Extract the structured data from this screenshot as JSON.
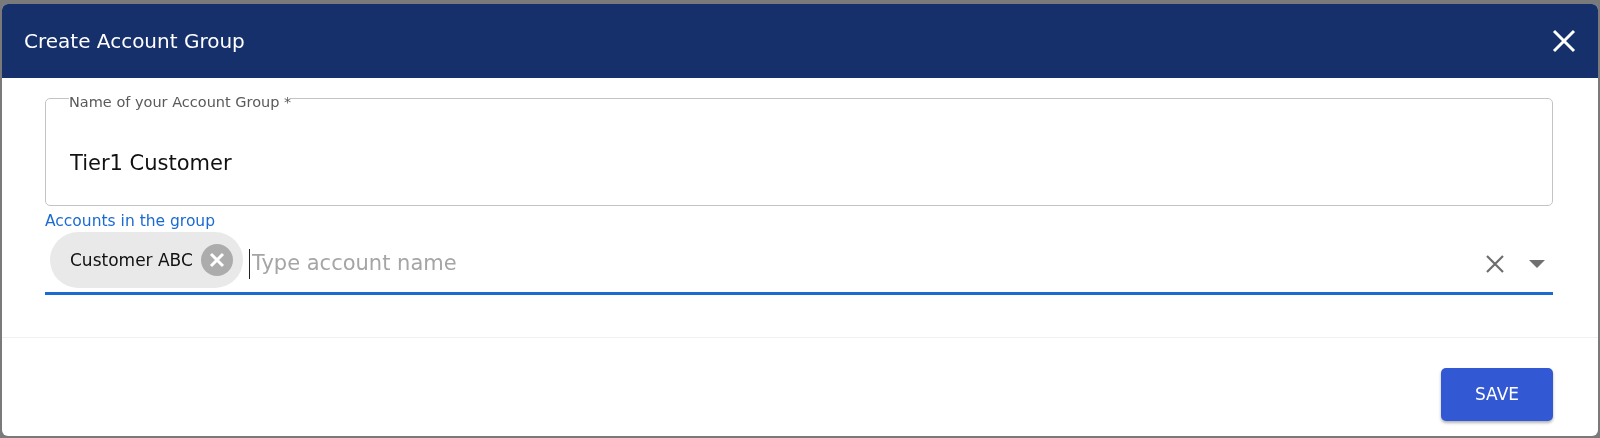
{
  "dialog": {
    "title": "Create Account Group"
  },
  "name_field": {
    "label": "Name of your Account Group *",
    "value": "Tier1 Customer"
  },
  "accounts_field": {
    "label": "Accounts in the group",
    "focused": true,
    "placeholder": "Type account name",
    "chips": [
      {
        "label": "Customer ABC"
      }
    ]
  },
  "buttons": [
    {
      "label": "SAVE"
    }
  ]
}
